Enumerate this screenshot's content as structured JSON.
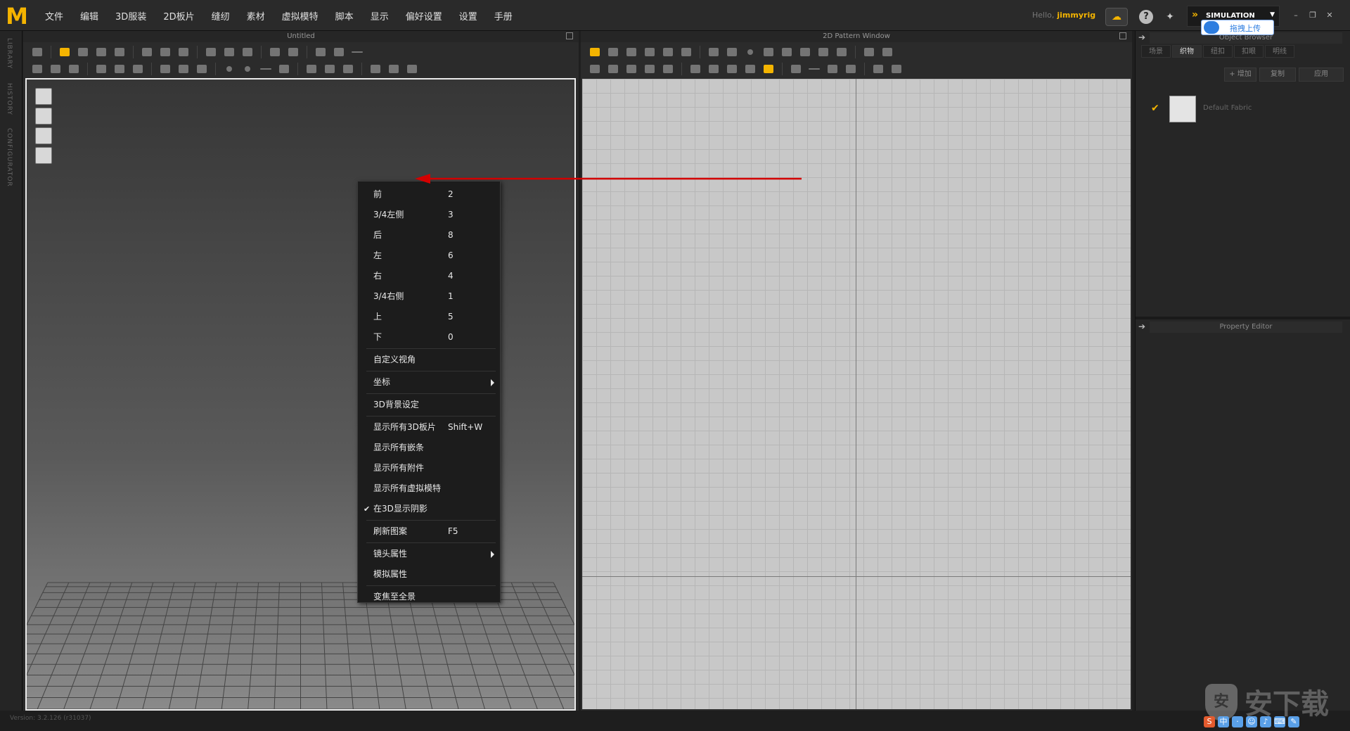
{
  "app": {
    "logo": "M",
    "menu": [
      "文件",
      "编辑",
      "3D服装",
      "2D板片",
      "缝纫",
      "素材",
      "虚拟模特",
      "脚本",
      "显示",
      "偏好设置",
      "设置",
      "手册"
    ],
    "hello_label": "Hello,",
    "username": "jimmyrig",
    "mode": "SIMULATION",
    "upload_label": "拖拽上传",
    "version": "Version: 3.2.126     (r31037)"
  },
  "left_strip": {
    "tabs": [
      "LIBRARY",
      "HISTORY",
      "CONFIGURATOR"
    ]
  },
  "panel3d": {
    "title": "Untitled"
  },
  "panel2d": {
    "title": "2D Pattern Window"
  },
  "context_menu": {
    "items": [
      {
        "label": "前",
        "shortcut": "2"
      },
      {
        "label": "3/4左侧",
        "shortcut": "3"
      },
      {
        "label": "后",
        "shortcut": "8"
      },
      {
        "label": "左",
        "shortcut": "6"
      },
      {
        "label": "右",
        "shortcut": "4"
      },
      {
        "label": "3/4右侧",
        "shortcut": "1"
      },
      {
        "label": "上",
        "shortcut": "5"
      },
      {
        "label": "下",
        "shortcut": "0"
      },
      {
        "label": "自定义视角",
        "shortcut": ""
      },
      {
        "label": "坐标",
        "shortcut": "",
        "submenu": true
      },
      {
        "label": "3D背景设定",
        "shortcut": ""
      },
      {
        "label": "显示所有3D板片",
        "shortcut": "Shift+W"
      },
      {
        "label": "显示所有嵌条",
        "shortcut": ""
      },
      {
        "label": "显示所有附件",
        "shortcut": ""
      },
      {
        "label": "显示所有虚拟模特",
        "shortcut": ""
      },
      {
        "label": "在3D显示阴影",
        "shortcut": "",
        "checked": true
      },
      {
        "label": "刷新图案",
        "shortcut": "F5"
      },
      {
        "label": "镜头属性",
        "shortcut": "",
        "submenu": true
      },
      {
        "label": "模拟属性",
        "shortcut": ""
      },
      {
        "label": "变焦至全景",
        "shortcut": ""
      }
    ]
  },
  "right_panel": {
    "object_browser_title": "Object Browser",
    "tabs": [
      "场景",
      "织物",
      "纽扣",
      "扣眼",
      "明线"
    ],
    "active_tab": "织物",
    "add_label": "+ 增加",
    "copy_label": "复制",
    "apply_label": "应用",
    "fabric_name": "Default Fabric",
    "property_editor_title": "Property Editor"
  },
  "watermark": {
    "text": "安下载"
  },
  "colors": {
    "accent": "#f4b400",
    "arrow": "#d40000"
  }
}
